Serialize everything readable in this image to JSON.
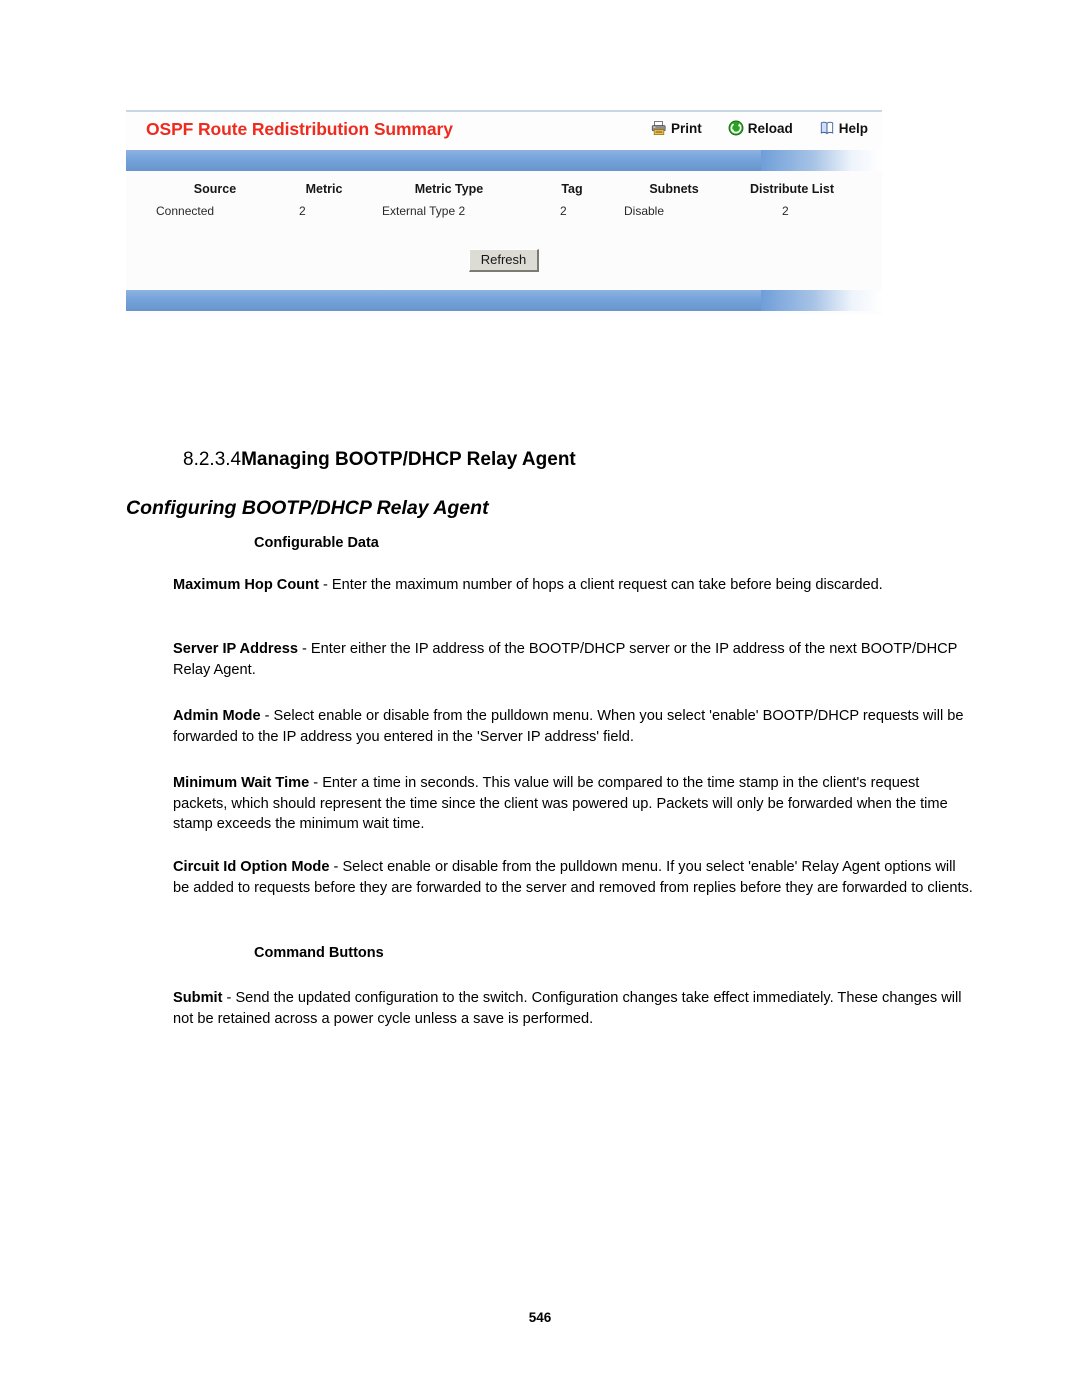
{
  "screenshot_panel": {
    "title": "OSPF Route Redistribution Summary",
    "accent_color": "#ee2b1e",
    "band_color": "#6f9ed9",
    "toolbar": [
      {
        "label": "Print",
        "icon": "printer-icon"
      },
      {
        "label": "Reload",
        "icon": "reload-icon"
      },
      {
        "label": "Help",
        "icon": "help-book-icon"
      }
    ],
    "table": {
      "headers": [
        "Source",
        "Metric",
        "Metric Type",
        "Tag",
        "Subnets",
        "Distribute List"
      ],
      "rows": [
        [
          "Connected",
          "2",
          "External Type 2",
          "2",
          "Disable",
          "2"
        ]
      ]
    },
    "refresh_button": "Refresh"
  },
  "document": {
    "section_number": "8.2.3.4",
    "section_title": "Managing BOOTP/DHCP Relay Agent",
    "subsection_title": "Configuring BOOTP/DHCP Relay Agent",
    "configurable_data_label": "Configurable Data",
    "command_buttons_label": "Command Buttons",
    "configurable_items": [
      {
        "term": "Maximum Hop Count",
        "separator": " - ",
        "description": "Enter the maximum number of hops a client request can take before being discarded."
      },
      {
        "term": "Server IP Address",
        "separator": " - ",
        "description": "Enter either the IP address of the BOOTP/DHCP server or the IP address of the next BOOTP/DHCP Relay Agent."
      },
      {
        "term": "Admin Mode",
        "separator": " - ",
        "description": "Select enable or disable from the pulldown menu. When you select 'enable' BOOTP/DHCP requests will be forwarded to the IP address you entered in the 'Server IP address' field."
      },
      {
        "term": "Minimum Wait Time",
        "separator": " - ",
        "description": "Enter a time in seconds. This value will be compared to the time stamp in the client's request packets, which should represent the time since the client was powered up. Packets will only be forwarded when the time stamp exceeds the minimum wait time."
      },
      {
        "term": "Circuit Id Option Mode",
        "separator": " - ",
        "description": "Select enable or disable from the pulldown menu. If you select 'enable' Relay Agent options will be added to requests before they are forwarded to the server and removed from replies before they are forwarded to clients."
      }
    ],
    "command_items": [
      {
        "term": "Submit",
        "separator": " - ",
        "description": "Send the updated configuration to the switch. Configuration changes take effect immediately. These changes will not be retained across a power cycle unless a save is performed."
      }
    ],
    "page_number": "546"
  }
}
